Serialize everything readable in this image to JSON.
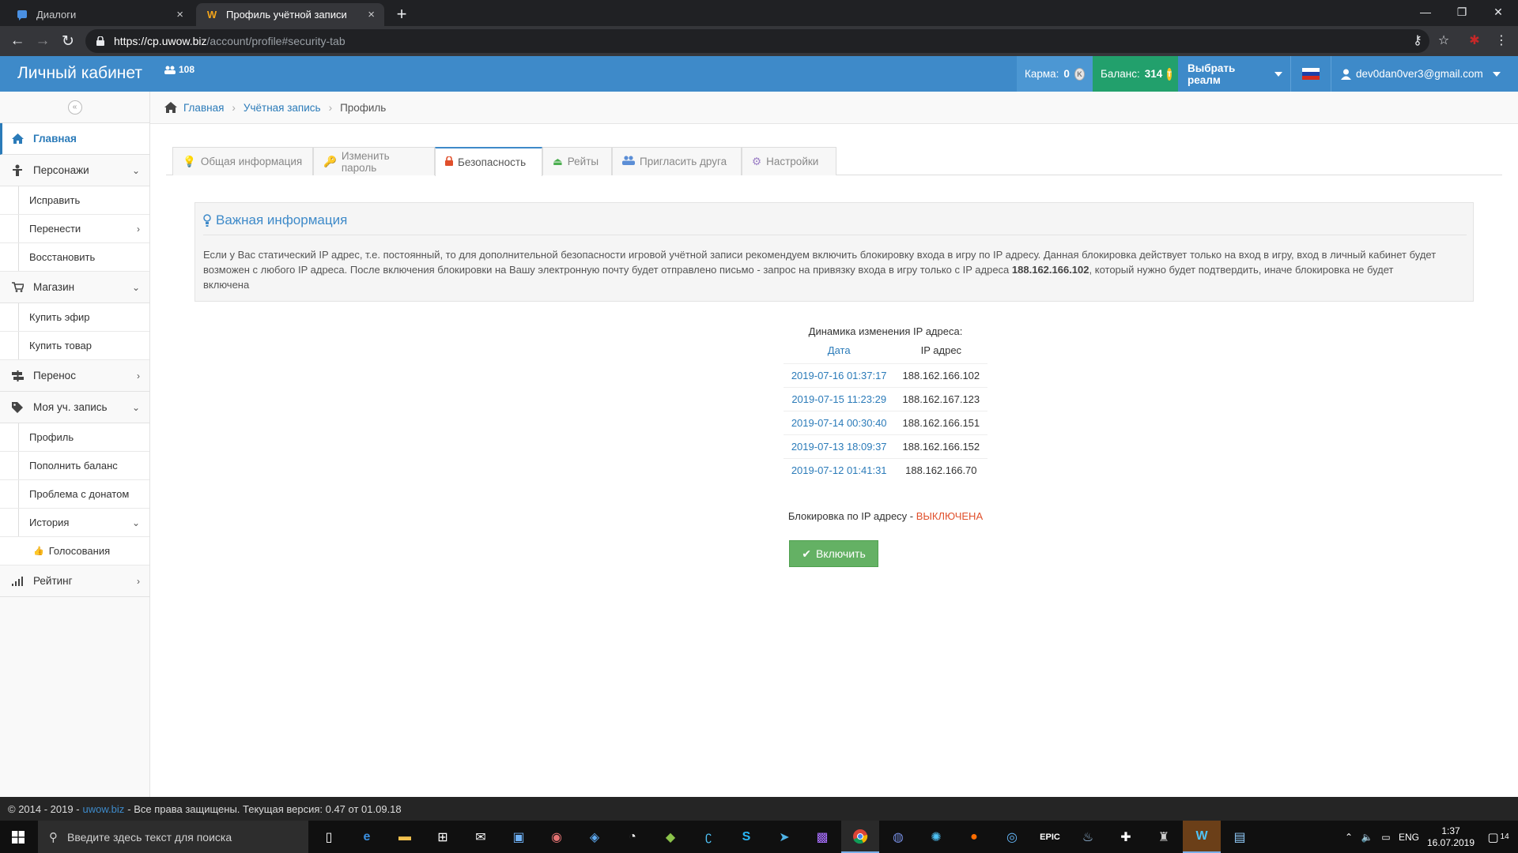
{
  "browser": {
    "tabs": [
      {
        "title": "Диалоги",
        "active": false
      },
      {
        "title": "Профиль учётной записи",
        "active": true
      }
    ],
    "url_host": "https://cp.uwow.biz",
    "url_path": "/account/profile#security-tab"
  },
  "header": {
    "brand": "Личный кабинет",
    "online_count": "108",
    "karma_label": "Карма:",
    "karma_value": "0",
    "karma_coin": "K",
    "balance_label": "Баланс:",
    "balance_value": "314",
    "balance_coin": "T",
    "realm_label": "Выбрать реалм",
    "user_email": "dev0dan0ver3@gmail.com"
  },
  "sidebar": {
    "items": [
      {
        "label": "Главная"
      },
      {
        "label": "Персонажи"
      },
      {
        "label": "Исправить"
      },
      {
        "label": "Перенести"
      },
      {
        "label": "Восстановить"
      },
      {
        "label": "Магазин"
      },
      {
        "label": "Купить эфир"
      },
      {
        "label": "Купить товар"
      },
      {
        "label": "Перенос"
      },
      {
        "label": "Моя уч. запись"
      },
      {
        "label": "Профиль"
      },
      {
        "label": "Пополнить баланс"
      },
      {
        "label": "Проблема с донатом"
      },
      {
        "label": "История"
      },
      {
        "label": "Голосования"
      },
      {
        "label": "Рейтинг"
      }
    ]
  },
  "breadcrumb": {
    "home": "Главная",
    "account": "Учётная запись",
    "current": "Профиль"
  },
  "tabs": [
    {
      "label": "Общая информация"
    },
    {
      "label": "Изменить пароль"
    },
    {
      "label": "Безопасность"
    },
    {
      "label": "Рейты"
    },
    {
      "label": "Пригласить друга"
    },
    {
      "label": "Настройки"
    }
  ],
  "info": {
    "title": "Важная информация",
    "text_1": "Если у Вас статический IP адрес, т.е. постоянный, то для дополнительной безопасности игровой учётной записи рекомендуем включить блокировку входа в игру по IP адресу. Данная блокировка действует только на вход в игру, вход в личный кабинет будет возможен с любого IP адреса. После включения блокировки на Вашу электронную почту будет отправлено письмо - запрос на привязку входа в игру только с IP адреса ",
    "ip": "188.162.166.102",
    "text_2": ", который нужно будет подтвердить, иначе блокировка не будет включена"
  },
  "history": {
    "caption": "Динамика изменения IP адреса:",
    "col_date": "Дата",
    "col_ip": "IP адрес",
    "rows": [
      {
        "date": "2019-07-16 01:37:17",
        "ip": "188.162.166.102"
      },
      {
        "date": "2019-07-15 11:23:29",
        "ip": "188.162.167.123"
      },
      {
        "date": "2019-07-14 00:30:40",
        "ip": "188.162.166.151"
      },
      {
        "date": "2019-07-13 18:09:37",
        "ip": "188.162.166.152"
      },
      {
        "date": "2019-07-12 01:41:31",
        "ip": "188.162.166.70"
      }
    ]
  },
  "lock": {
    "label": "Блокировка по IP адресу - ",
    "status": "ВЫКЛЮЧЕНА",
    "button": "Включить"
  },
  "footer": {
    "prefix": "© 2014 - 2019 -",
    "link": "uwow.biz",
    "suffix": "- Все права защищены. Текущая версия: 0.47 от 01.09.18"
  },
  "taskbar": {
    "search_placeholder": "Введите здесь текст для поиска",
    "lang": "ENG",
    "time": "1:37",
    "date": "16.07.2019",
    "notifications": "14"
  },
  "colors": {
    "header_bg": "#3e8ac9",
    "balance_bg": "#22a06c",
    "link": "#2b7bb9",
    "status_off": "#e04f2b",
    "button_green": "#64b164"
  }
}
